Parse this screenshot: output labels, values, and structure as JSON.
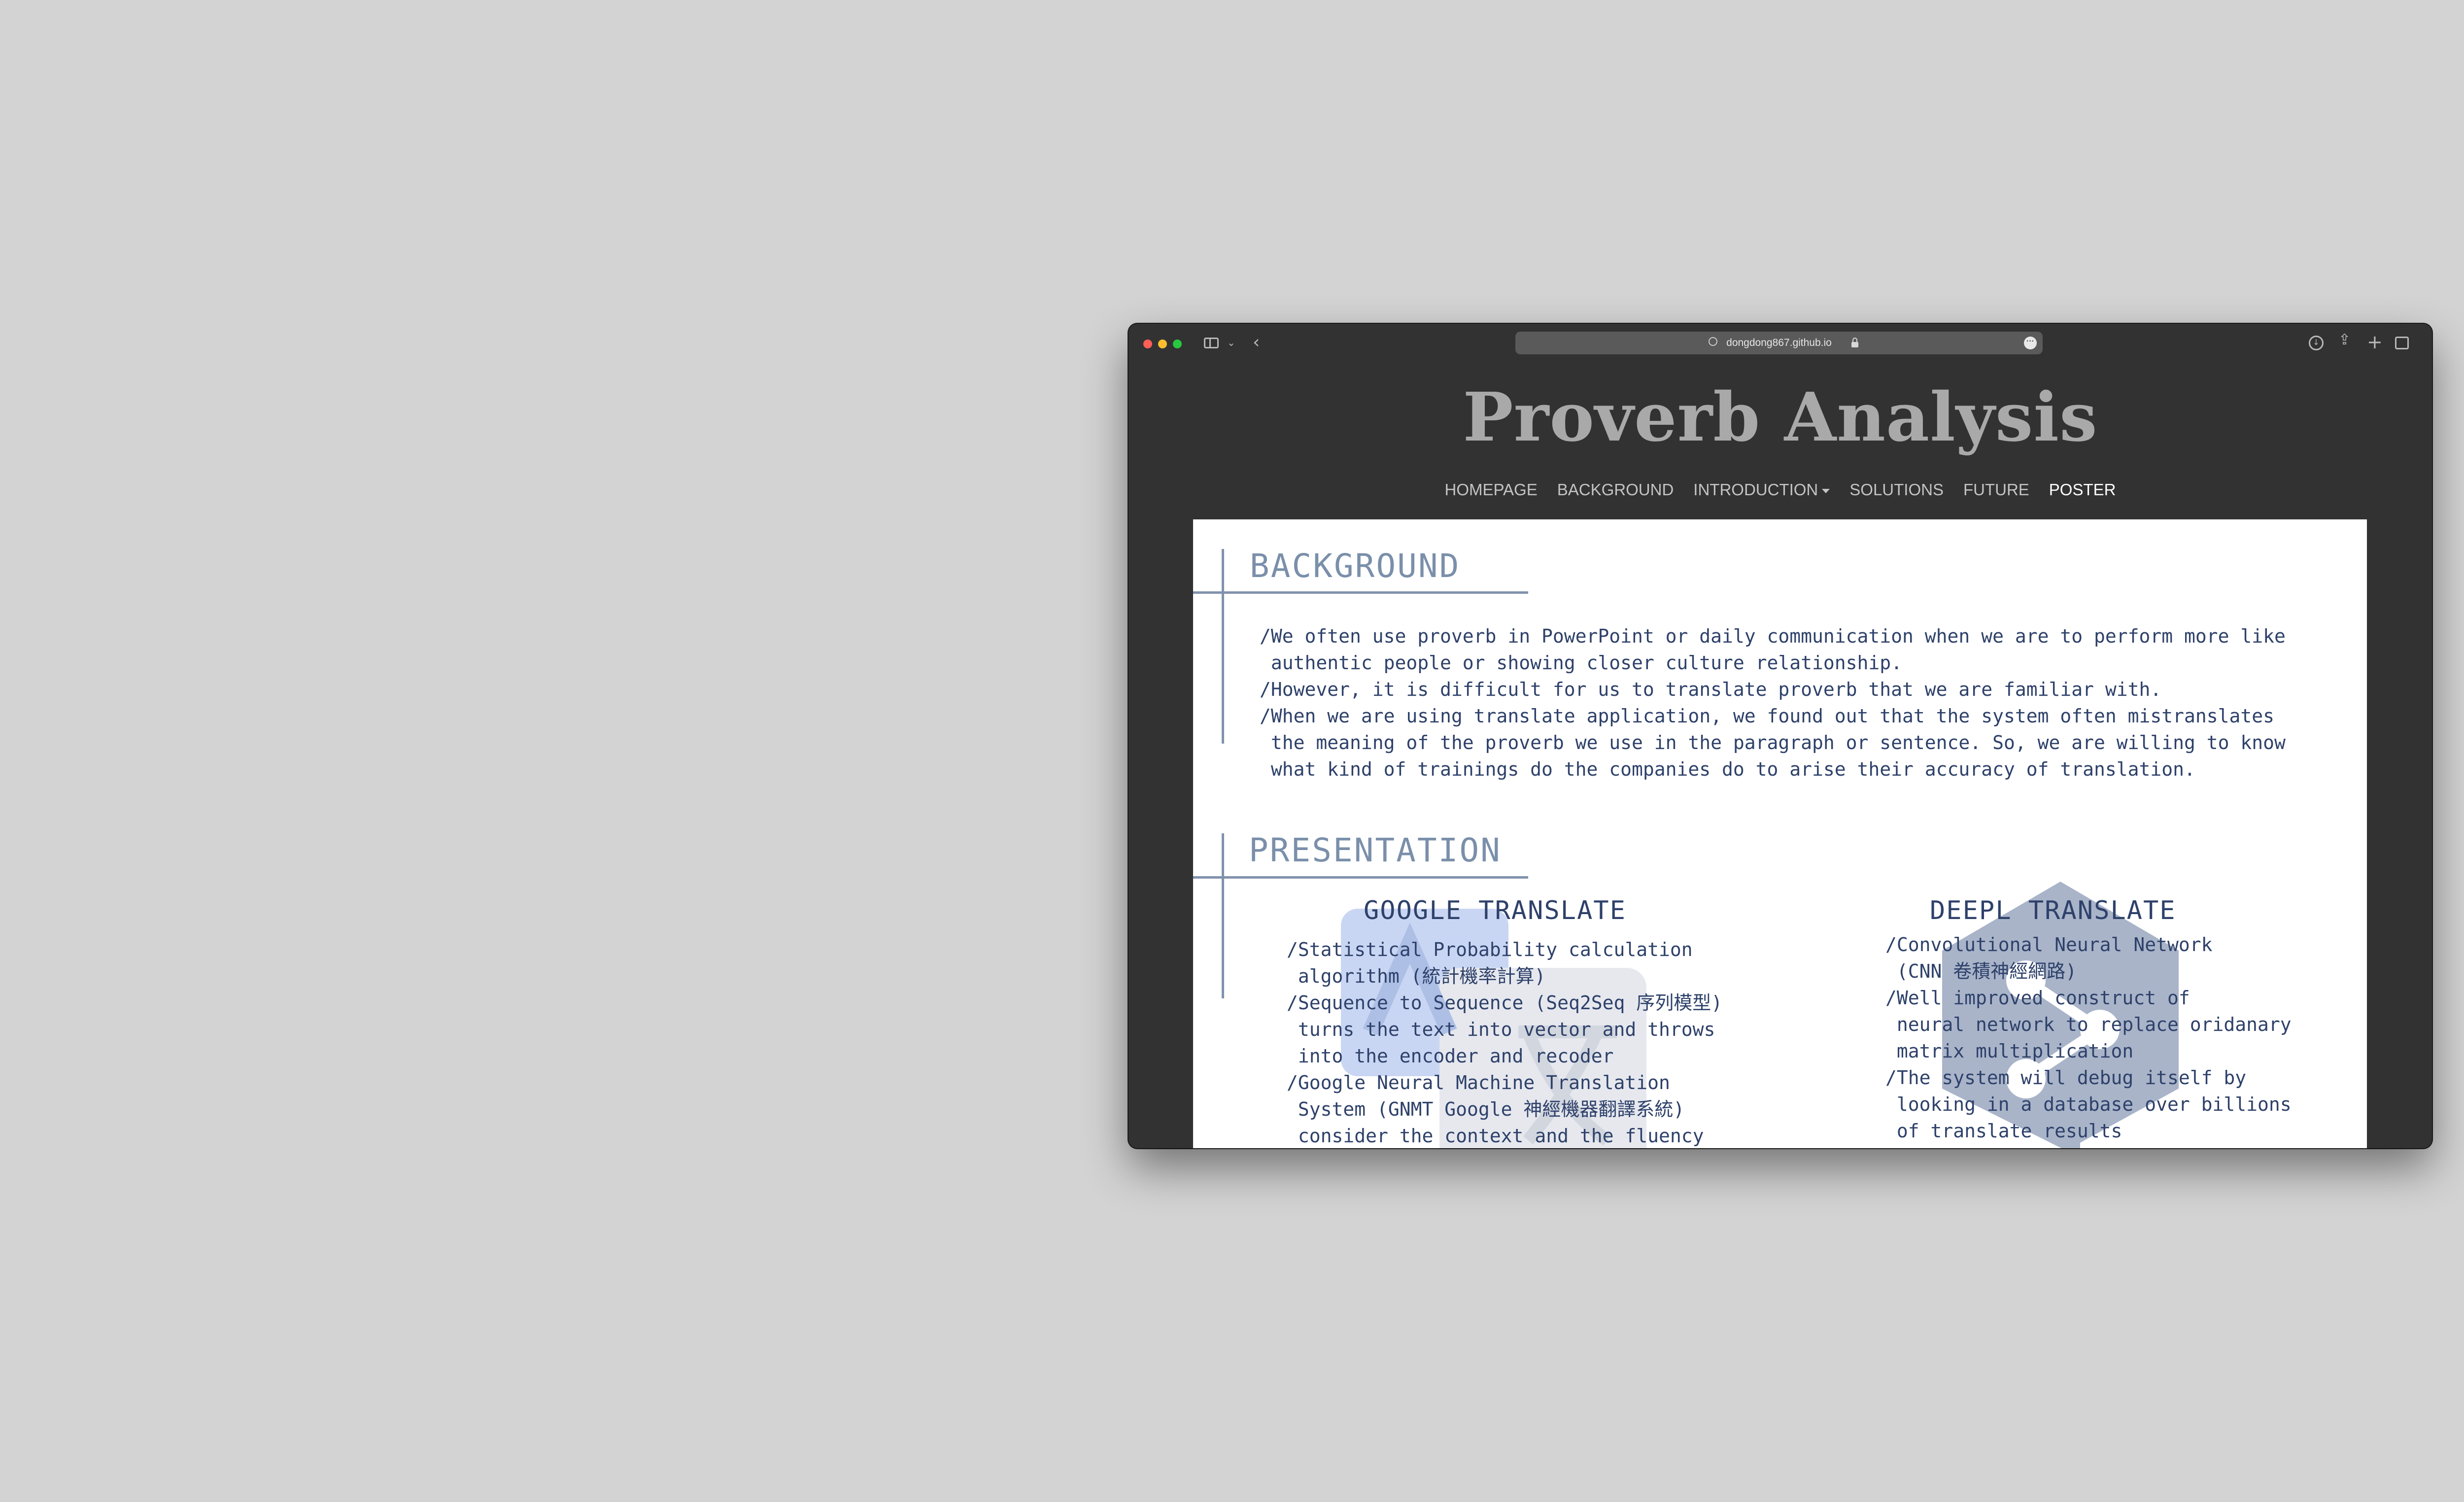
{
  "browser": {
    "url": "dongdong867.github.io"
  },
  "site": {
    "title": "Proverb Analysis"
  },
  "nav": {
    "items": [
      "HOMEPAGE",
      "BACKGROUND",
      "INTRODUCTION",
      "SOLUTIONS",
      "FUTURE",
      "POSTER"
    ]
  },
  "background": {
    "heading": "BACKGROUND",
    "lines": [
      "/We often use proverb in PowerPoint or daily communication when we are to perform more like",
      " authentic people or showing closer culture relationship.",
      "/However, it is difficult for us to translate proverb that we are familiar with.",
      "/When we are using translate application, we found out that the system often mistranslates",
      " the meaning of the proverb we use in the paragraph or sentence. So, we are willing to know",
      " what kind of trainings do the companies do to arise their accuracy of translation."
    ]
  },
  "presentation": {
    "heading": "PRESENTATION",
    "google": {
      "title": "GOOGLE TRANSLATE",
      "lines": [
        "/Statistical Probability calculation",
        " algorithm (統計機率計算)",
        "/Sequence to Sequence (Seq2Seq 序列模型)",
        " turns the text into vector and throws",
        " into the encoder and recoder",
        "/Google Neural Machine Translation",
        " System (GNMT Google 神經機器翻譯系統)",
        " consider the context and the fluency"
      ]
    },
    "deepl": {
      "title": "DEEPL TRANSLATE",
      "lines": [
        "/Convolutional Neural Network",
        " (CNN 卷積神經網路)",
        "/Well improved construct of",
        " neural network to replace oridanary",
        " matrix multiplication",
        "/The system will debug itself by",
        " looking in a database over billions",
        " of translate results"
      ]
    }
  },
  "colors": {
    "desktop": "#d3d3d3",
    "window": "#323232",
    "heading": "#7a8faa",
    "text": "#2e416a",
    "google_watermark": "#c9d6f3",
    "deepl_watermark": "#a9b4c9"
  },
  "icons": [
    "sidebar-icon",
    "chevron-down-icon",
    "back-icon",
    "globe-icon",
    "lock-icon",
    "more-icon",
    "download-icon",
    "share-icon",
    "new-tab-icon",
    "tabs-overview-icon",
    "google-translate-logo",
    "deepl-logo"
  ]
}
